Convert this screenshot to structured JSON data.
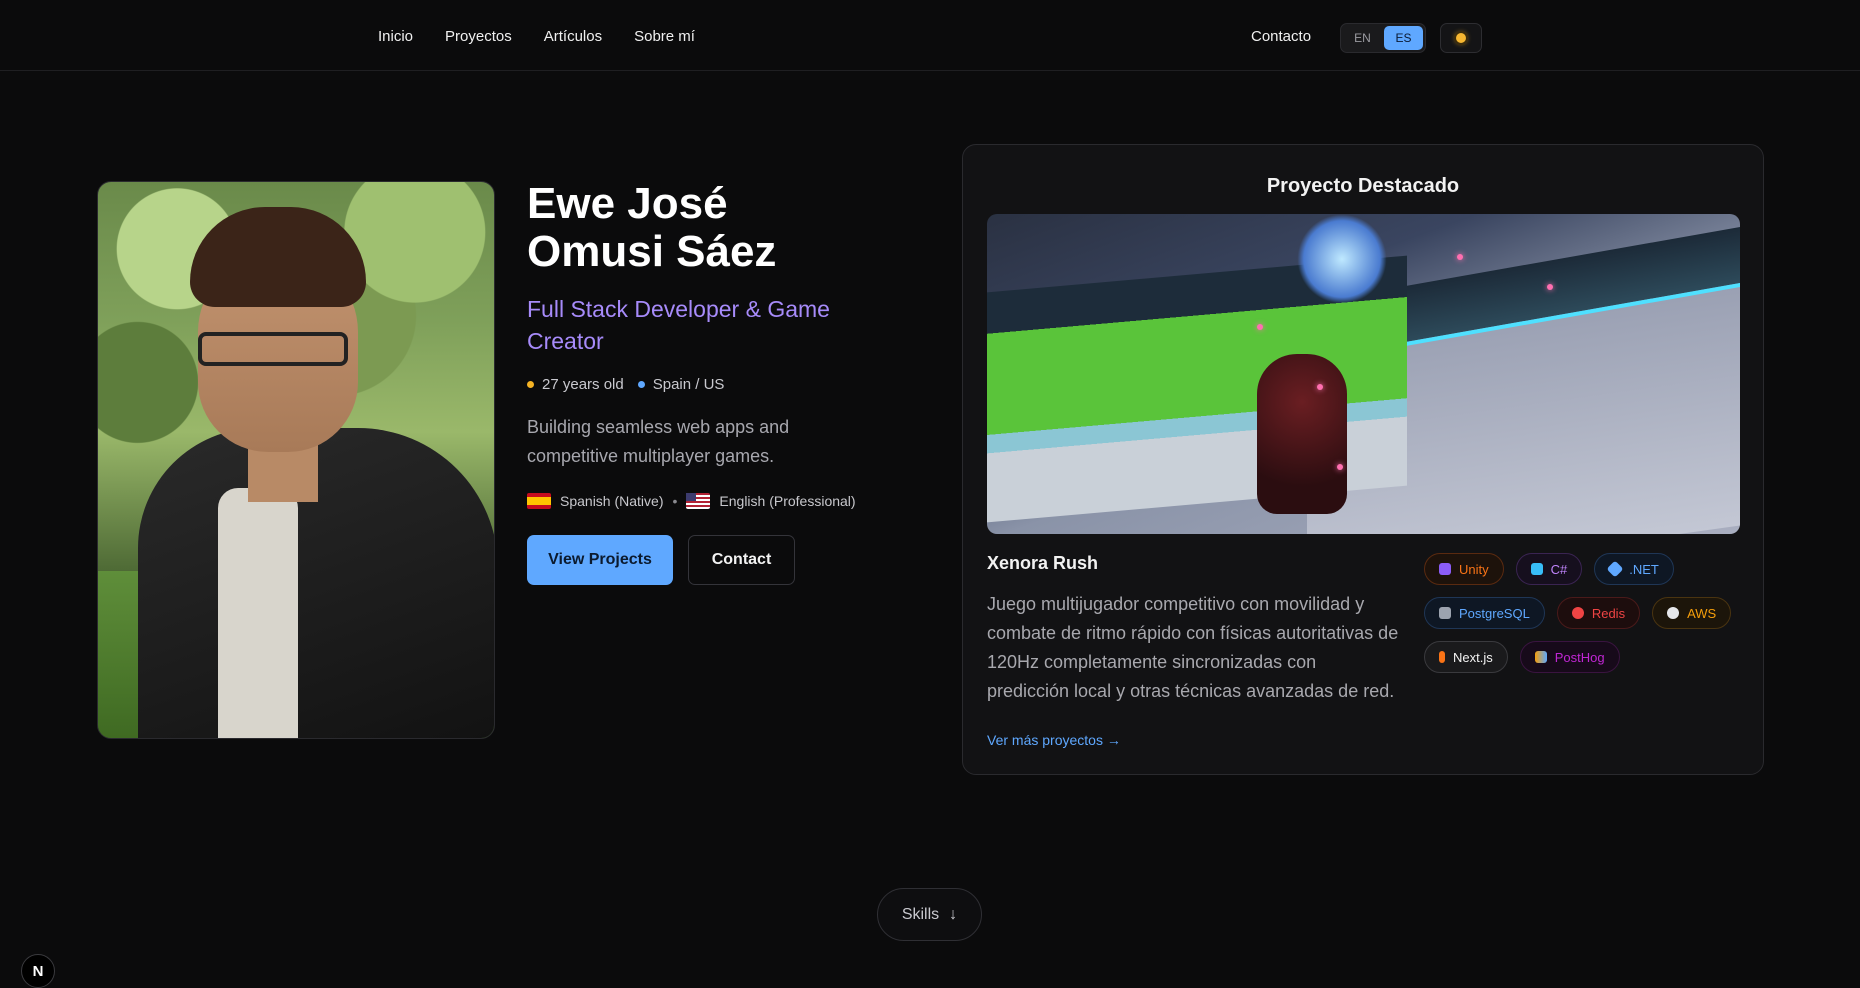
{
  "nav": {
    "links": [
      "Inicio",
      "Proyectos",
      "Artículos",
      "Sobre mí"
    ],
    "contact": "Contacto",
    "lang": {
      "en": "EN",
      "es": "ES",
      "active": "ES"
    },
    "theme_icon": "sun-icon"
  },
  "hero": {
    "name": "Ewe José Omusi Sáez",
    "role": "Full Stack Developer & Game Creator",
    "age": "27 years old",
    "location": "Spain / US",
    "bio": "Building seamless web apps and competitive multiplayer games.",
    "languages": [
      {
        "flag": "flag-es",
        "label": "Spanish (Native)"
      },
      {
        "flag": "flag-us",
        "label": "English (Professional)"
      }
    ],
    "separator": "•",
    "primary_button": "View Projects",
    "secondary_button": "Contact"
  },
  "featured": {
    "heading": "Proyecto Destacado",
    "project_name": "Xenora Rush",
    "description": "Juego multijugador competitivo con movilidad y combate de ritmo rápido con físicas autoritativas de 120Hz completamente sincronizadas con predicción local y otras técnicas avanzadas de red.",
    "more_link": "Ver más proyectos →",
    "tags": [
      {
        "label": "Unity",
        "icon": "gamepad-icon",
        "color": "#f97316"
      },
      {
        "label": "C#",
        "icon": "gem-icon",
        "color": "#c084fc"
      },
      {
        "label": ".NET",
        "icon": "diamond-icon",
        "color": "#5fa8ff"
      },
      {
        "label": "PostgreSQL",
        "icon": "elephant-icon",
        "color": "#5fa8ff"
      },
      {
        "label": "Redis",
        "icon": "redis-icon",
        "color": "#ef4444"
      },
      {
        "label": "AWS",
        "icon": "cloud-icon",
        "color": "#f59e0b"
      },
      {
        "label": "Next.js",
        "icon": "bolt-icon",
        "color": "#f3f3f3"
      },
      {
        "label": "PostHog",
        "icon": "chart-icon",
        "color": "#c026d3"
      }
    ]
  },
  "skills": {
    "label": "Skills",
    "arrow": "↓"
  },
  "badge": "N",
  "colors": {
    "accent": "#5fa8ff",
    "role": "#a78bfa",
    "dot_age": "#f5b324",
    "dot_loc": "#5fa8ff"
  }
}
